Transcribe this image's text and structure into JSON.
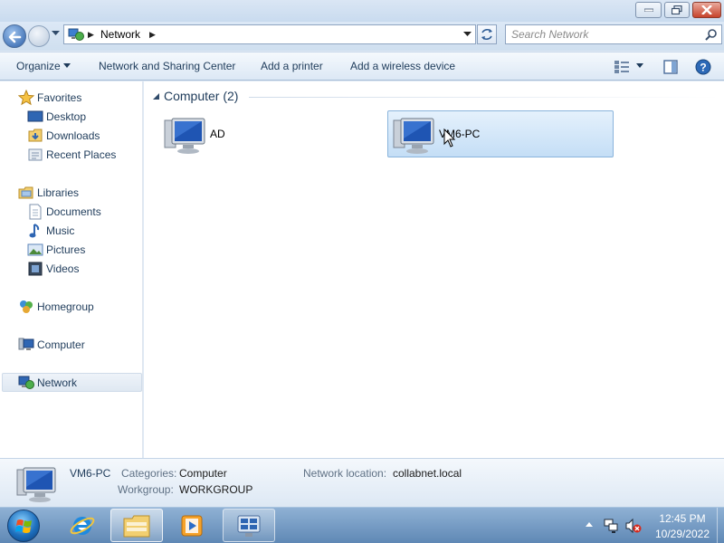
{
  "window": {
    "caption_buttons": [
      "minimize",
      "maximize",
      "close"
    ]
  },
  "address": {
    "location": "Network",
    "search_placeholder": "Search Network"
  },
  "toolbar": {
    "organize": "Organize",
    "network_center": "Network and Sharing Center",
    "add_printer": "Add a printer",
    "add_wireless": "Add a wireless device"
  },
  "sidebar": {
    "favorites": {
      "label": "Favorites",
      "items": [
        {
          "label": "Desktop",
          "icon": "desktop-icon"
        },
        {
          "label": "Downloads",
          "icon": "downloads-icon"
        },
        {
          "label": "Recent Places",
          "icon": "recent-places-icon"
        }
      ]
    },
    "libraries": {
      "label": "Libraries",
      "items": [
        {
          "label": "Documents",
          "icon": "documents-icon"
        },
        {
          "label": "Music",
          "icon": "music-icon"
        },
        {
          "label": "Pictures",
          "icon": "pictures-icon"
        },
        {
          "label": "Videos",
          "icon": "videos-icon"
        }
      ]
    },
    "homegroup": "Homegroup",
    "computer": "Computer",
    "network": "Network",
    "selected": "Network"
  },
  "content": {
    "group_title": "Computer (2)",
    "items": [
      {
        "name": "AD",
        "selected": false
      },
      {
        "name": "VM6-PC",
        "selected": true
      }
    ]
  },
  "details": {
    "name": "VM6-PC",
    "categories_label": "Categories:",
    "categories_value": "Computer",
    "workgroup_label": "Workgroup:",
    "workgroup_value": "WORKGROUP",
    "location_label": "Network location:",
    "location_value": "collabnet.local"
  },
  "taskbar": {
    "time": "12:45 PM",
    "date": "10/29/2022",
    "pinned": [
      "internet-explorer-icon",
      "windows-explorer-icon",
      "media-player-icon",
      "server-manager-icon"
    ]
  },
  "colors": {
    "selection": "#c4def6",
    "selection_border": "#8ab4dc",
    "taskbar": "#6d93bd",
    "close_button": "#c7432b"
  }
}
